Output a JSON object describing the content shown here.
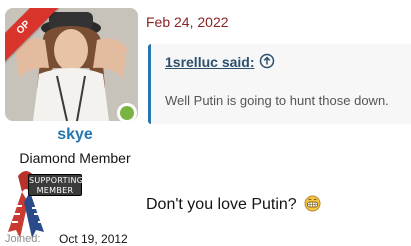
{
  "user": {
    "badge": "OP",
    "username": "skye",
    "title": "Diamond Member",
    "banner_line1": "SUPPORTING",
    "banner_line2": "MEMBER",
    "joined_label": "Joined:",
    "joined_value": "Oct 19, 2012"
  },
  "post": {
    "date": "Feb 24, 2022",
    "quote_author": "1srelluc said:",
    "quote_text": "Well Putin is going to hunt those down.",
    "text": "Don't you love Putin?",
    "emoji": "grinning-face-icon"
  },
  "colors": {
    "username": "#2577b1",
    "date": "#8a2424",
    "quote_border": "#2577b1",
    "op_ribbon": "#d9342b",
    "online": "#7bb343"
  }
}
